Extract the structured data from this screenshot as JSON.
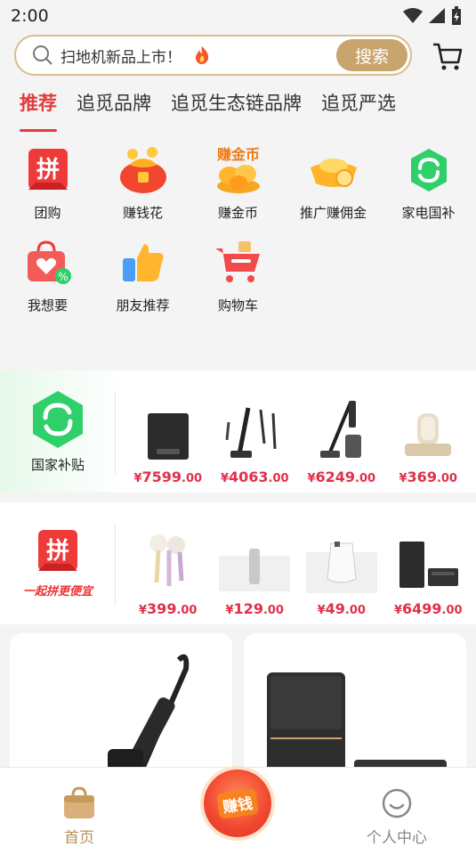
{
  "status_bar": {
    "time": "2:00"
  },
  "search": {
    "placeholder": "扫地机新品上市！",
    "button_label": "搜索"
  },
  "tabs": [
    {
      "label": "推荐",
      "active": true
    },
    {
      "label": "追觅品牌"
    },
    {
      "label": "追觅生态链品牌"
    },
    {
      "label": "追觅严选"
    }
  ],
  "grid": {
    "row1": [
      {
        "label": "团购",
        "icon": "pin-icon"
      },
      {
        "label": "赚钱花",
        "icon": "money-bag-icon"
      },
      {
        "label": "赚金币",
        "icon": "gold-coin-icon"
      },
      {
        "label": "推广赚佣金",
        "icon": "gold-ingot-icon"
      },
      {
        "label": "家电国补",
        "icon": "subsidy-icon"
      }
    ],
    "row2": [
      {
        "label": "我想要",
        "icon": "wishlist-bag-icon"
      },
      {
        "label": "朋友推荐",
        "icon": "thumbs-up-icon"
      },
      {
        "label": "购物车",
        "icon": "cart-icon"
      }
    ],
    "coin_icon_text": "赚金币"
  },
  "subsidy_panel": {
    "label": "国家补贴",
    "products": [
      {
        "int": "7599",
        "dec": ".00"
      },
      {
        "int": "4063",
        "dec": ".00"
      },
      {
        "int": "6249",
        "dec": ".00"
      },
      {
        "int": "369",
        "dec": ".00"
      }
    ]
  },
  "group_panel": {
    "icon_char": "拼",
    "slogan": "一起拼更便宜",
    "products": [
      {
        "int": "399",
        "dec": ".00"
      },
      {
        "int": "129",
        "dec": ".00"
      },
      {
        "int": "49",
        "dec": ".00"
      },
      {
        "int": "6499",
        "dec": ".00"
      }
    ]
  },
  "currency": "¥",
  "bottom_nav": {
    "home": "首页",
    "earn": "赚钱",
    "me": "个人中心"
  },
  "colors": {
    "accent_red": "#e23b3b",
    "gold": "#c9a46c",
    "price_red": "#e0304a",
    "subsidy_green": "#2fcf6a"
  }
}
